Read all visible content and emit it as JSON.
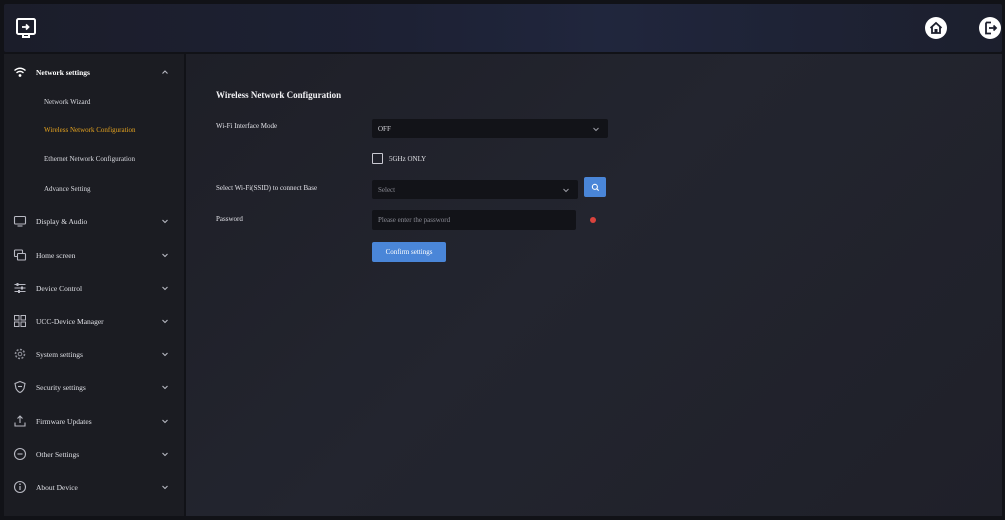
{
  "header": {
    "logo_icon": "screen-share-icon",
    "home_icon": "home-icon",
    "logout_icon": "logout-icon"
  },
  "sidebar": {
    "groups": [
      {
        "label": "Network settings",
        "icon": "wifi-icon",
        "expanded": true
      },
      {
        "label": "Display & Audio",
        "icon": "monitor-icon"
      },
      {
        "label": "Home screen",
        "icon": "windows-icon"
      },
      {
        "label": "Device Control",
        "icon": "sliders-icon"
      },
      {
        "label": "UCC-Device Manager",
        "icon": "grid-icon"
      },
      {
        "label": "System settings",
        "icon": "gear-icon"
      },
      {
        "label": "Security settings",
        "icon": "shield-icon"
      },
      {
        "label": "Firmware Updates",
        "icon": "upload-icon"
      },
      {
        "label": "Other Settings",
        "icon": "more-circle-icon"
      },
      {
        "label": "About Device",
        "icon": "info-icon"
      }
    ],
    "network_items": [
      {
        "label": "Network Wizard"
      },
      {
        "label": "Wireless Network Configuration",
        "active": true
      },
      {
        "label": "Ethernet Network Configuration"
      },
      {
        "label": "Advance Setting"
      }
    ]
  },
  "main": {
    "title": "Wireless Network Configuration",
    "wifi_mode": {
      "label": "Wi-Fi Interface Mode",
      "value": "OFF"
    },
    "checkbox_5ghz": {
      "label": "5GHz ONLY",
      "checked": false
    },
    "ssid": {
      "label": "Select Wi-Fi(SSID) to connect Base",
      "placeholder": "Select"
    },
    "password": {
      "label": "Password",
      "placeholder": "Please enter the password"
    },
    "confirm_label": "Confirm settings"
  },
  "colors": {
    "accent": "#4a86d8",
    "active_nav": "#e5a31f",
    "required": "#d9433d"
  }
}
